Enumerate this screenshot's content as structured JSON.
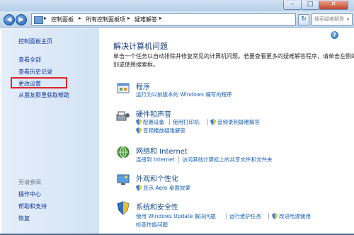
{
  "navigation": {
    "back_icon": "back-arrow-icon",
    "forward_icon": "forward-arrow-icon",
    "breadcrumbs": [
      "控制面板",
      "所有控制面板项",
      "疑难解答"
    ],
    "search_placeholder": "搜索疑难解答",
    "refresh_icon": "refresh-icon"
  },
  "sidebar": {
    "links": {
      "home": "控制面板主页",
      "view_all": "查看全部",
      "view_history": "查看历史记录",
      "change_settings": "更改设置",
      "get_help_from_friend": "从朋友那里获取帮助"
    },
    "see_also": {
      "heading": "另请参阅",
      "items": [
        "操作中心",
        "帮助和支持",
        "恢复"
      ]
    }
  },
  "main": {
    "title": "解决计算机问题",
    "description_lines": [
      "单击一个任务以自动排除并修复常见的计算机问题。若要查看更多的疑难解答程序，请单击左侧的类",
      "别或使用搜索框。"
    ],
    "categories": [
      {
        "title": "程序",
        "icon": "programs-icon",
        "links": [
          "运行为以前版本的 Windows 编写的程序"
        ]
      },
      {
        "title": "硬件和声音",
        "icon": "hardware-sound-icon",
        "links": [
          "配置设备",
          "使用打印机",
          "音频录制疑难解答",
          "音频播放疑难解答"
        ]
      },
      {
        "title": "网络和 Internet",
        "icon": "network-internet-icon",
        "links": [
          "连接到 Internet",
          "访问其他计算机上的共享文件和文件夹"
        ]
      },
      {
        "title": "外观和个性化",
        "icon": "appearance-icon",
        "links": [
          "显示 Aero 桌面效果"
        ]
      },
      {
        "title": "系统和安全性",
        "icon": "system-security-icon",
        "links": [
          "使用 Windows Update 解决问题",
          "运行维护任务",
          "改进电源使用",
          "检查性能问题"
        ]
      }
    ]
  },
  "colors": {
    "link_blue": "#1a5fb4",
    "title_blue": "#1d3a78",
    "highlight_red": "#d9262a",
    "sidebar_bg": "#dbe8f6"
  }
}
